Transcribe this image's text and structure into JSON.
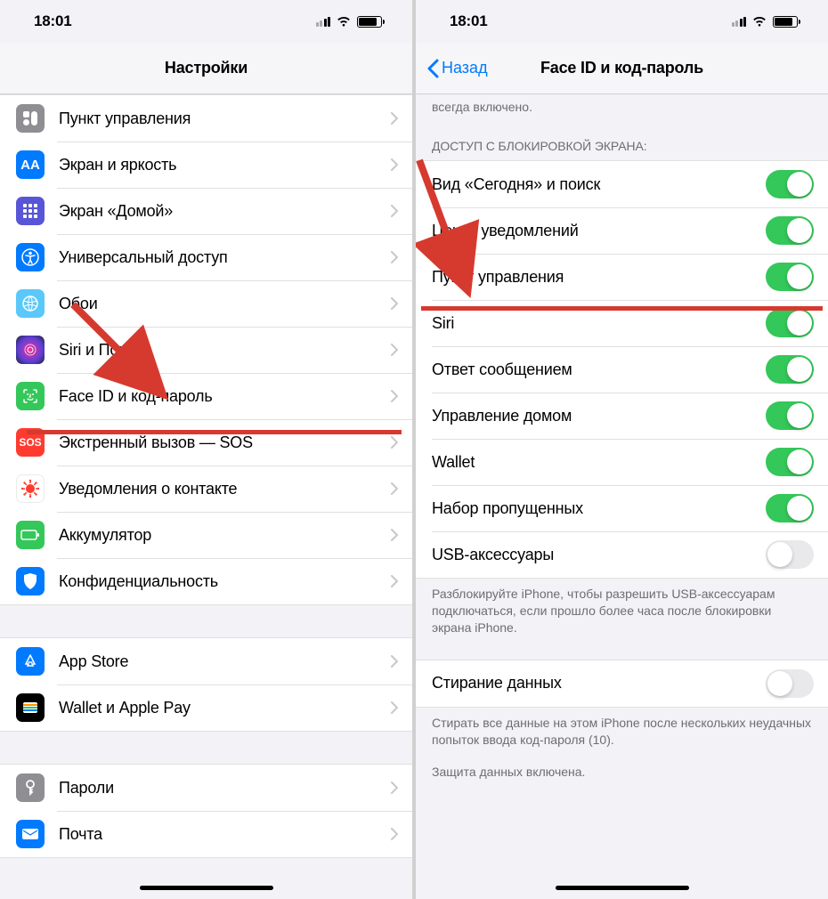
{
  "status": {
    "time": "18:01"
  },
  "left": {
    "title": "Настройки",
    "rows": [
      {
        "label": "Пункт управления"
      },
      {
        "label": "Экран и яркость"
      },
      {
        "label": "Экран «Домой»"
      },
      {
        "label": "Универсальный доступ"
      },
      {
        "label": "Обои"
      },
      {
        "label": "Siri и Поиск"
      },
      {
        "label": "Face ID и код-пароль"
      },
      {
        "label": "Экстренный вызов — SOS"
      },
      {
        "label": "Уведомления о контакте"
      },
      {
        "label": "Аккумулятор"
      },
      {
        "label": "Конфиденциальность"
      }
    ],
    "group2": [
      {
        "label": "App Store"
      },
      {
        "label": "Wallet и Apple Pay"
      }
    ],
    "group3": [
      {
        "label": "Пароли"
      },
      {
        "label": "Почта"
      }
    ]
  },
  "right": {
    "back": "Назад",
    "title": "Face ID и код-пароль",
    "top_partial": "всегда включено.",
    "section_header": "ДОСТУП С БЛОКИРОВКОЙ ЭКРАНА:",
    "toggles": [
      {
        "label": "Вид «Сегодня» и поиск",
        "on": true
      },
      {
        "label": "Центр уведомлений",
        "on": true
      },
      {
        "label": "Пункт управления",
        "on": true
      },
      {
        "label": "Siri",
        "on": true
      },
      {
        "label": "Ответ сообщением",
        "on": true
      },
      {
        "label": "Управление домом",
        "on": true
      },
      {
        "label": "Wallet",
        "on": true
      },
      {
        "label": "Набор пропущенных",
        "on": true
      },
      {
        "label": "USB-аксессуары",
        "on": false
      }
    ],
    "usb_footer": "Разблокируйте iPhone, чтобы разрешить USB-аксессуарам подключаться, если прошло более часа после блокировки экрана iPhone.",
    "erase": {
      "label": "Стирание данных",
      "on": false
    },
    "erase_footer1": "Стирать все данные на этом iPhone после нескольких неудачных попыток ввода код-пароля (10).",
    "erase_footer2": "Защита данных включена."
  }
}
